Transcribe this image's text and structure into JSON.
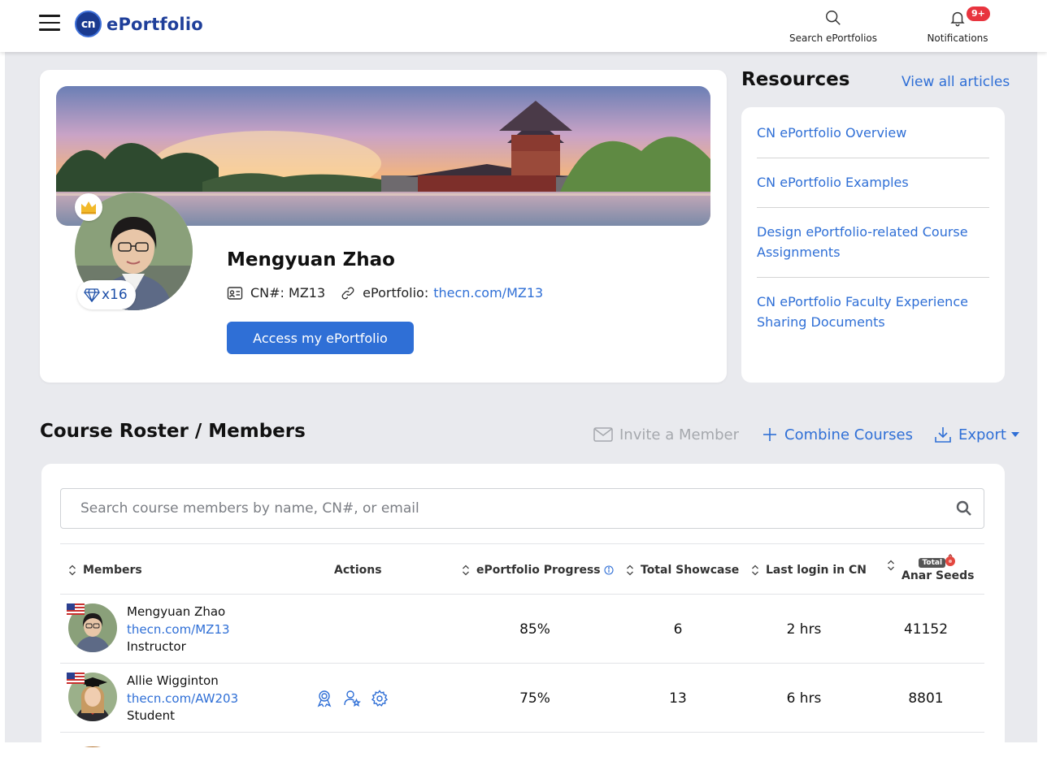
{
  "app": {
    "name": "ePortfolio",
    "logo_letters": "cn"
  },
  "topbar": {
    "search_label": "Search ePortfolios",
    "notifications_label": "Notifications",
    "notifications_badge": "9+"
  },
  "profile": {
    "name": "Mengyuan Zhao",
    "gem_count": "x16",
    "cn_label": "CN#: MZ13",
    "eportfolio_label": "ePortfolio:",
    "eportfolio_link": "thecn.com/MZ13",
    "access_button": "Access my ePortfolio"
  },
  "resources": {
    "title": "Resources",
    "view_all": "View all articles",
    "items": [
      "CN ePortfolio Overview",
      "CN ePortfolio Examples",
      "Design ePortfolio-related Course Assignments",
      "CN ePortfolio Faculty Experience Sharing Documents"
    ]
  },
  "roster": {
    "title": "Course Roster / Members",
    "invite": "Invite a Member",
    "combine": "Combine Courses",
    "export": "Export",
    "search_placeholder": "Search course members by name, CN#, or email",
    "columns": {
      "members": "Members",
      "actions": "Actions",
      "progress": "ePortfolio Progress",
      "showcase": "Total Showcase",
      "last_login": "Last login in CN",
      "seeds_badge": "Total",
      "seeds": "Anar Seeds"
    },
    "rows": [
      {
        "name": "Mengyuan Zhao",
        "link": "thecn.com/MZ13",
        "role": "Instructor",
        "progress": "85%",
        "showcase": "6",
        "last_login": "2 hrs",
        "seeds": "41152"
      },
      {
        "name": "Allie Wigginton",
        "link": "thecn.com/AW203",
        "role": "Student",
        "progress": "75%",
        "showcase": "13",
        "last_login": "6 hrs",
        "seeds": "8801"
      }
    ]
  },
  "colors": {
    "accent": "#2f6fd6",
    "brand": "#1f3f9a",
    "badge": "#e8343e",
    "page_bg": "#e9eaee"
  }
}
